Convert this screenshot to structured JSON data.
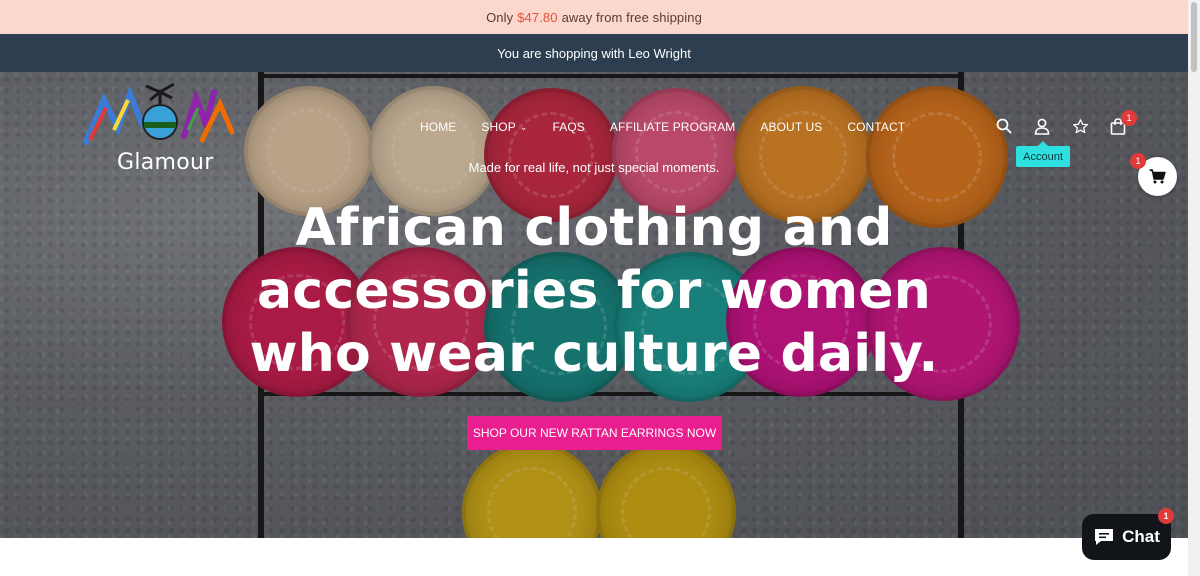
{
  "shipping_bar": {
    "prefix": "Only",
    "amount": "$47.80",
    "suffix": "away from free shipping"
  },
  "shopper_bar": {
    "text": "You are shopping with Leo Wright"
  },
  "logo": {
    "name": "Glamour"
  },
  "nav": {
    "items": [
      {
        "label": "HOME"
      },
      {
        "label": "SHOP"
      },
      {
        "label": "FAQS"
      },
      {
        "label": "AFFILIATE PROGRAM"
      },
      {
        "label": "ABOUT US"
      },
      {
        "label": "CONTACT"
      }
    ]
  },
  "header_icons": {
    "search": "search-icon",
    "account": "user-icon",
    "wishlist": "star-icon",
    "cart": "bag-icon",
    "cart_count": "1",
    "account_tooltip": "Account"
  },
  "floating_cart": {
    "icon": "cart-icon",
    "count": "1"
  },
  "hero": {
    "tagline": "Made for real life, not just special moments.",
    "headline_line1": "African clothing and",
    "headline_line2": "accessories for women",
    "headline_line3": "who wear culture daily.",
    "cta_label": "SHOP OUR NEW RATTAN EARRINGS NOW"
  },
  "chat": {
    "label": "Chat",
    "count": "1",
    "icon": "chat-bubble-icon"
  },
  "colors": {
    "shipping_bar_bg": "#fcd7cc",
    "shipping_amount": "#e0533d",
    "shopper_bar_bg": "#2c3e50",
    "cta_bg": "#e91e8f",
    "tooltip_bg": "#2ee0e0",
    "badge": "#e03a3a"
  }
}
